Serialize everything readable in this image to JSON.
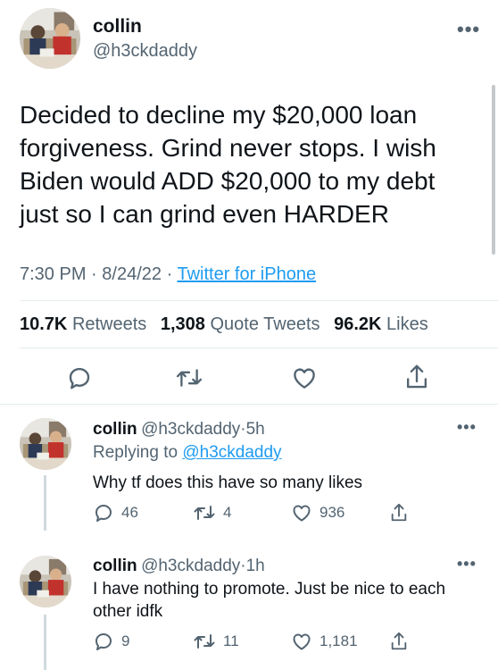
{
  "main_tweet": {
    "name": "collin",
    "handle": "@h3ckdaddy",
    "text": "Decided to decline my $20,000 loan forgiveness. Grind never stops. I wish Biden would ADD $20,000 to my debt just so I can grind even HARDER",
    "time": "7:30 PM",
    "date": "8/24/22",
    "source": "Twitter for iPhone",
    "stats": {
      "retweets_count": "10.7K",
      "retweets_label": "Retweets",
      "quotes_count": "1,308",
      "quotes_label": "Quote Tweets",
      "likes_count": "96.2K",
      "likes_label": "Likes"
    },
    "actions": [
      "reply-icon",
      "retweet-icon",
      "like-icon",
      "share-icon"
    ]
  },
  "replies": [
    {
      "name": "collin",
      "handle": "@h3ckdaddy",
      "age": "5h",
      "replying_prefix": "Replying to",
      "replying_to": "@h3ckdaddy",
      "text": "Why tf does this have so many likes",
      "reply_count": "46",
      "retweet_count": "4",
      "like_count": "936"
    },
    {
      "name": "collin",
      "handle": "@h3ckdaddy",
      "age": "1h",
      "text": "I have nothing to promote. Just be nice to each other idfk",
      "reply_count": "9",
      "retweet_count": "11",
      "like_count": "1,181"
    }
  ],
  "ui": {
    "more": "•••",
    "dot": "·",
    "accent": "#1d9bf0",
    "muted": "#536471"
  }
}
